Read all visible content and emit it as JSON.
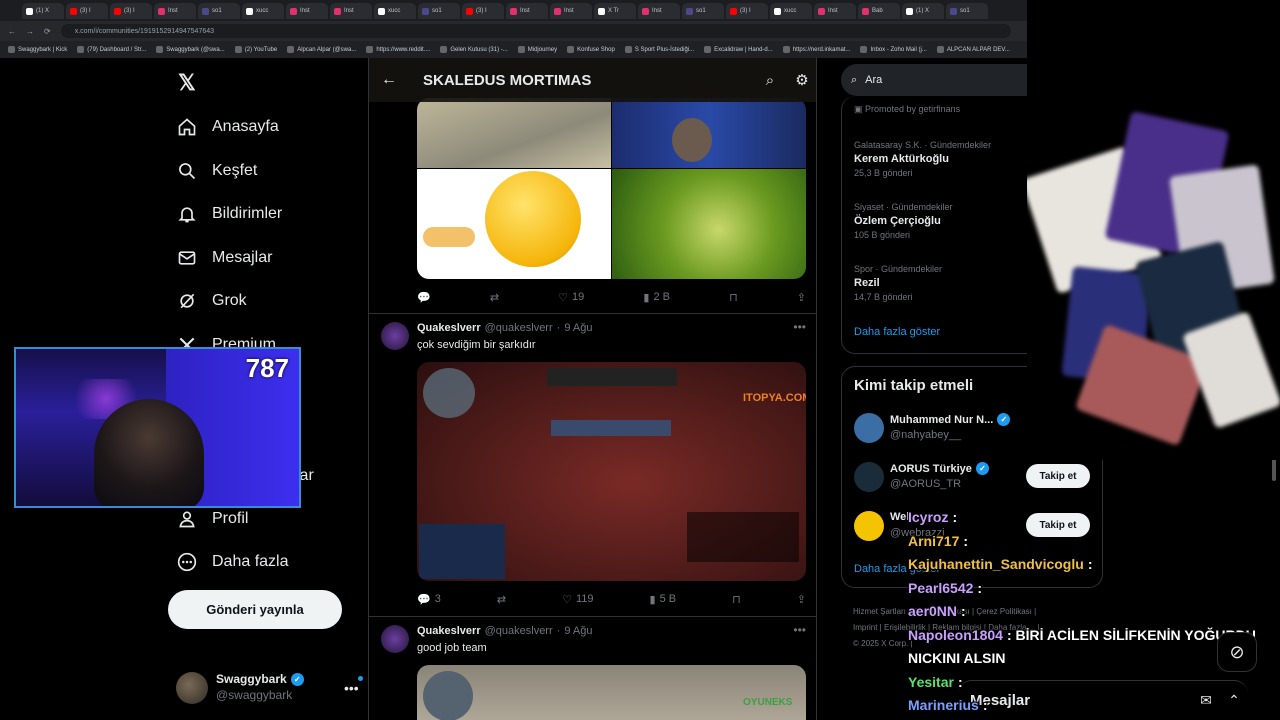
{
  "browser": {
    "tabs": [
      {
        "label": "(1) X",
        "color": "#ffffff"
      },
      {
        "label": "(3) I",
        "color": "#ff0000"
      },
      {
        "label": "(3) I",
        "color": "#ff0000"
      },
      {
        "label": "Inst",
        "color": "#e1306c"
      },
      {
        "label": "so1",
        "color": "#4a4a8a"
      },
      {
        "label": "xucc",
        "color": "#ffffff"
      },
      {
        "label": "Inst",
        "color": "#e1306c"
      },
      {
        "label": "Inst",
        "color": "#e1306c"
      },
      {
        "label": "xucc",
        "color": "#ffffff"
      },
      {
        "label": "so1",
        "color": "#4a4a8a"
      },
      {
        "label": "(3) I",
        "color": "#ff0000"
      },
      {
        "label": "Inst",
        "color": "#e1306c"
      },
      {
        "label": "Inst",
        "color": "#e1306c"
      },
      {
        "label": "X Tr",
        "color": "#ffffff"
      },
      {
        "label": "Inst",
        "color": "#e1306c"
      },
      {
        "label": "so1",
        "color": "#4a4a8a"
      },
      {
        "label": "(3) I",
        "color": "#ff0000"
      },
      {
        "label": "xucc",
        "color": "#ffffff"
      },
      {
        "label": "Inst",
        "color": "#e1306c"
      },
      {
        "label": "Bab",
        "color": "#e1306c"
      },
      {
        "label": "(1) X",
        "color": "#ffffff"
      },
      {
        "label": "so1",
        "color": "#4a4a8a"
      }
    ],
    "url": "x.com/i/communities/1919152914947547643",
    "bookmarks": [
      "Swaggybark | Kick",
      "(79) Dashboard / Str...",
      "Swaggybark (@swa...",
      "(2) YouTube",
      "Alpcan Alpar (@swa...",
      "https://www.reddit....",
      "Gelen Kutusu (31) -...",
      "Midjourney",
      "Konfuse Shop",
      "S Sport Plus-İstediği...",
      "Excalidraw | Hand-d...",
      "https://nerd.inkamat...",
      "Inbox - Zoho Mail (j...",
      "ALPCAN ALPAR DEV..."
    ]
  },
  "nav": {
    "items": [
      {
        "label": "Anasayfa",
        "icon": "home-icon"
      },
      {
        "label": "Keşfet",
        "icon": "search-icon"
      },
      {
        "label": "Bildirimler",
        "icon": "bell-icon"
      },
      {
        "label": "Mesajlar",
        "icon": "mail-icon"
      },
      {
        "label": "Grok",
        "icon": "grok-icon"
      },
      {
        "label": "Premium",
        "icon": "x-icon"
      }
    ],
    "partial_item": "şlar",
    "profile": "Profil",
    "more": "Daha fazla",
    "post_button": "Gönderi yayınla",
    "account": {
      "name": "Swaggybark",
      "handle": "@swaggybark"
    }
  },
  "feed": {
    "title": "SKALEDUS MORTIMAS",
    "first_actions": {
      "likes": "19",
      "views": "2 B"
    },
    "tweets": [
      {
        "author": "Quakeslverr",
        "handle": "@quakeslverr",
        "date": "9 Ağu",
        "text": "çok sevdiğim bir şarkıdır",
        "watermark": "ITOPYA.COM",
        "replies": "3",
        "likes": "119",
        "views": "5 B"
      },
      {
        "author": "Quakeslverr",
        "handle": "@quakeslverr",
        "date": "9 Ağu",
        "text": "good job team",
        "watermark": "OYUNEKS"
      }
    ]
  },
  "right": {
    "search_placeholder": "Ara",
    "promoted": "Promoted by getirfinans",
    "trends": [
      {
        "context": "Galatasaray S.K. · Gündemdekiler",
        "name": "Kerem Aktürkoğlu",
        "count": "25,3 B gönderi"
      },
      {
        "context": "Siyaset · Gündemdekiler",
        "name": "Özlem Çerçioğlu",
        "count": "105 B gönderi"
      },
      {
        "context": "Spor · Gündemdekiler",
        "name": "Rezil",
        "count": "14,7 B gönderi"
      }
    ],
    "trends_more": "Daha fazla göster",
    "who_to_follow": "Kimi takip etmeli",
    "suggestions": [
      {
        "name": "Muhammed Nur N...",
        "handle": "@nahyabey__",
        "avatar_color": "#3a6ea5"
      },
      {
        "name": "AORUS Türkiye",
        "handle": "@AORUS_TR",
        "avatar_color": "#1a2b3a",
        "button": "Takip et"
      },
      {
        "name": "Web",
        "handle": "@webrazzi",
        "avatar_color": "#f5c400",
        "button": "Takip et"
      }
    ],
    "follow_more": "Daha fazla göster",
    "footer": [
      "Hizmet Şartları",
      "Gizlilik Politikası",
      "Çerez Politikası",
      "Imprint",
      "Erişilebilirlik",
      "Reklam bilgisi",
      "Daha fazla ...",
      "© 2025 X Corp."
    ]
  },
  "overlay": {
    "viewer_count": "787",
    "chat": [
      {
        "user": "Icyroz",
        "text": "",
        "color": "#c9a0ff"
      },
      {
        "user": "Arni717",
        "text": "",
        "color": "#f0c040"
      },
      {
        "user": "Kajuhanettin_Sandvicoglu",
        "text": "",
        "color": "#f0c040"
      },
      {
        "user": "Pearl6542",
        "text": "",
        "color": "#c9a0ff"
      },
      {
        "user": "aer0NN",
        "text": "",
        "color": "#c9a0ff"
      },
      {
        "user": "Napoleon1804",
        "text": "BİRİ ACİLEN SİLİFKENİN YOĞURDU",
        "color": "#c9a0ff"
      },
      {
        "user": "",
        "text": "NICKINI ALSIN",
        "color": "#ffffff"
      },
      {
        "user": "Yesitar",
        "text": "",
        "color": "#5ee06a"
      },
      {
        "user": "Marinerius",
        "text": "",
        "color": "#7aa0ff"
      }
    ],
    "messages_label": "Mesajlar"
  }
}
